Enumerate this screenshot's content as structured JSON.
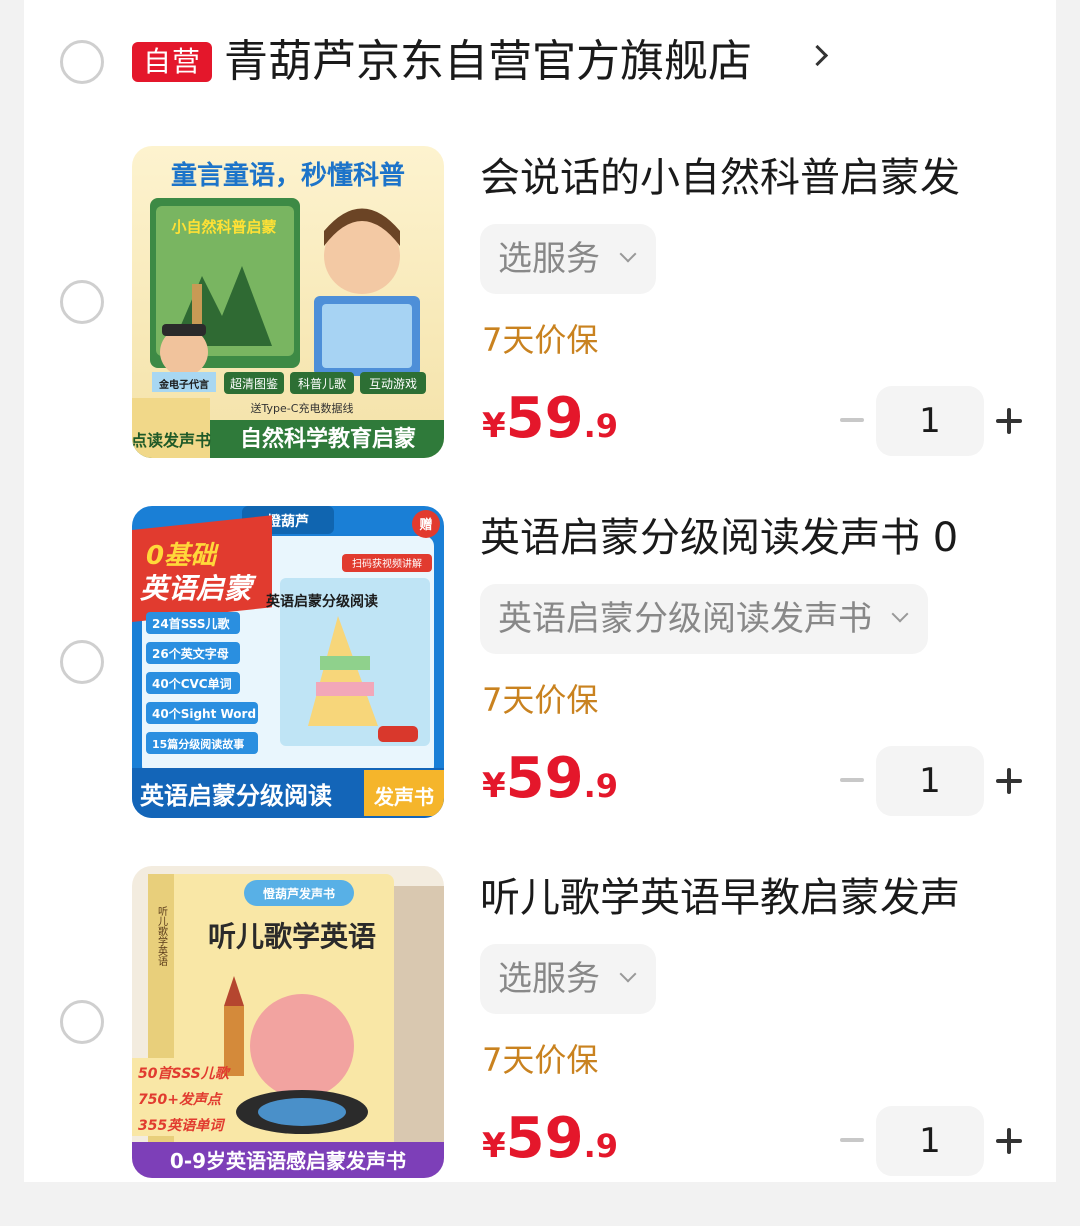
{
  "shop": {
    "badge": "自营",
    "name": "青葫芦京东自营官方旗舰店"
  },
  "colors": {
    "accent_red": "#e4172b",
    "protect_orange": "#c9821f",
    "chip_gray": "#f4f4f4"
  },
  "items": [
    {
      "title": "会说话的小自然科普启蒙发",
      "service": "选服务",
      "protect": "7天价保",
      "price_currency": "¥",
      "price_int": "59",
      "price_dec": ".9",
      "qty": "1",
      "image": {
        "headline": "童言童语，秒懂科普",
        "cover_title": "小自然科普启蒙",
        "features": [
          "超清图鉴",
          "科普儿歌",
          "互动游戏"
        ],
        "side_tag": "金电子代言",
        "gift": "送Type-C充电数据线",
        "corner": "点读发声书",
        "footer": "自然科学教育启蒙"
      }
    },
    {
      "title": "英语启蒙分级阅读发声书 0",
      "service": "英语启蒙分级阅读发声书",
      "protect": "7天价保",
      "price_currency": "¥",
      "price_int": "59",
      "price_dec": ".9",
      "qty": "1",
      "image": {
        "brand": "憕葫芦",
        "gift": "赠",
        "headline1": "0基础",
        "headline2": "英语启蒙",
        "scan": "扫码获视频讲解",
        "book_title": "英语启蒙分级阅读",
        "features": [
          "24首SSS儿歌",
          "26个英文字母",
          "40个CVC单词",
          "40个Sight Word",
          "15篇分级阅读故事"
        ],
        "footer": "英语启蒙分级阅读",
        "footer_tag": "发声书"
      }
    },
    {
      "title": "听儿歌学英语早教启蒙发声",
      "service": "选服务",
      "protect": "7天价保",
      "price_currency": "¥",
      "price_int": "59",
      "price_dec": ".9",
      "qty": "1",
      "image": {
        "top_tag": "憕葫芦发声书",
        "book_title": "听儿歌学英语",
        "spine": "听儿歌学英语",
        "stats": [
          "50首SSS儿歌",
          "750+发声点",
          "355英语单词"
        ],
        "footer": "0-9岁英语语感启蒙发声书"
      }
    }
  ]
}
